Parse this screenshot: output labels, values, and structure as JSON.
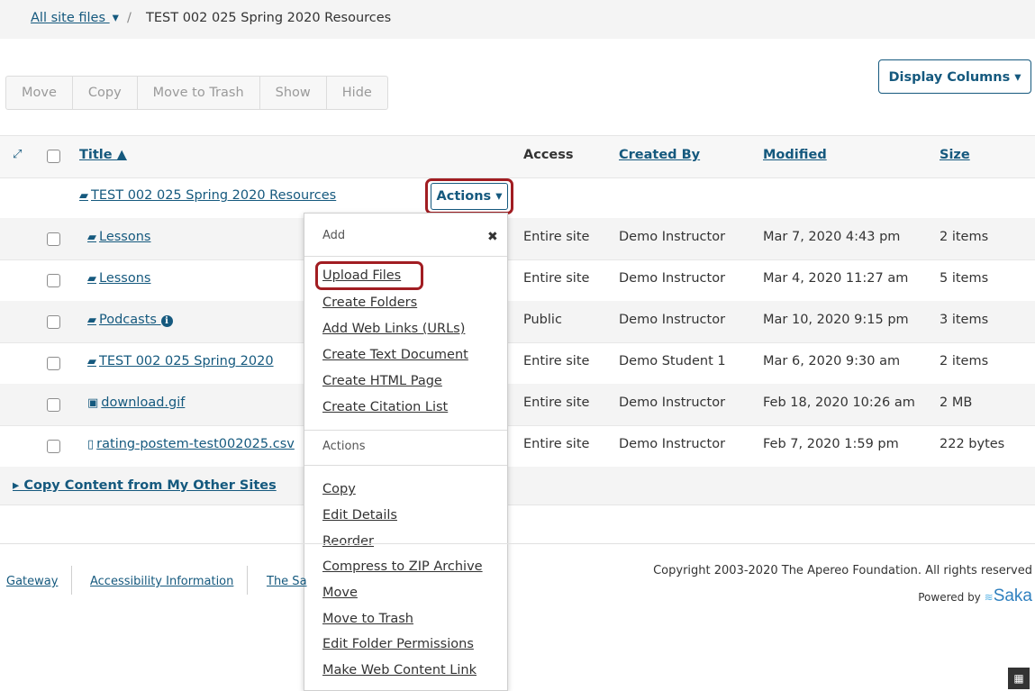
{
  "breadcrumb": {
    "root": "All site files",
    "root_caret": "▾",
    "separator": "/",
    "current": "TEST 002 025 Spring 2020 Resources"
  },
  "toolbar": {
    "buttons": [
      "Move",
      "Copy",
      "Move to Trash",
      "Show",
      "Hide"
    ]
  },
  "display_columns": "Display Columns ▾",
  "table": {
    "headers": {
      "title": "Title ▲",
      "access": "Access",
      "created_by": "Created By",
      "modified": "Modified",
      "size": "Size"
    },
    "parent_folder": "TEST 002 025 Spring 2020 Resources",
    "actions_label": "Actions ▾",
    "rows": [
      {
        "title": "Lessons",
        "access": "Entire site",
        "created_by": "Demo Instructor",
        "modified": "Mar 7, 2020 4:43 pm",
        "size": "2 items"
      },
      {
        "title": "Lessons",
        "access": "Entire site",
        "created_by": "Demo Instructor",
        "modified": "Mar 4, 2020 11:27 am",
        "size": "5 items"
      },
      {
        "title": "Podcasts",
        "access": "Public",
        "created_by": "Demo Instructor",
        "modified": "Mar 10, 2020 9:15 pm",
        "size": "3 items"
      },
      {
        "title": "TEST 002 025 Spring 2020",
        "access": "Entire site",
        "created_by": "Demo Student 1",
        "modified": "Mar 6, 2020 9:30 am",
        "size": "2 items"
      },
      {
        "title": "download.gif",
        "access": "Entire site",
        "created_by": "Demo Instructor",
        "modified": "Feb 18, 2020 10:26 am",
        "size": "2 MB"
      },
      {
        "title": "rating-postem-test002025.csv",
        "access": "Entire site",
        "created_by": "Demo Instructor",
        "modified": "Feb 7, 2020 1:59 pm",
        "size": "222 bytes"
      }
    ]
  },
  "menu": {
    "add_header": "Add",
    "close": "✖",
    "add_items": [
      "Upload Files",
      "Create Folders",
      "Add Web Links (URLs)",
      "Create Text Document",
      "Create HTML Page",
      "Create Citation List"
    ],
    "actions_header": "Actions",
    "action_items": [
      "Copy",
      "Edit Details",
      "Reorder",
      "Compress to ZIP Archive",
      "Move",
      "Move to Trash",
      "Edit Folder Permissions",
      "Make Web Content Link"
    ]
  },
  "copy_content": "▸ Copy Content from My Other Sites",
  "footer": {
    "links": [
      "Gateway",
      "Accessibility Information",
      "The Sa"
    ],
    "copyright": "Copyright 2003-2020 The Apereo Foundation. All rights reserved",
    "powered_by": "Powered by",
    "logo_text": "Saka"
  },
  "colors": {
    "link": "#15597e",
    "highlight": "#a11d22"
  }
}
